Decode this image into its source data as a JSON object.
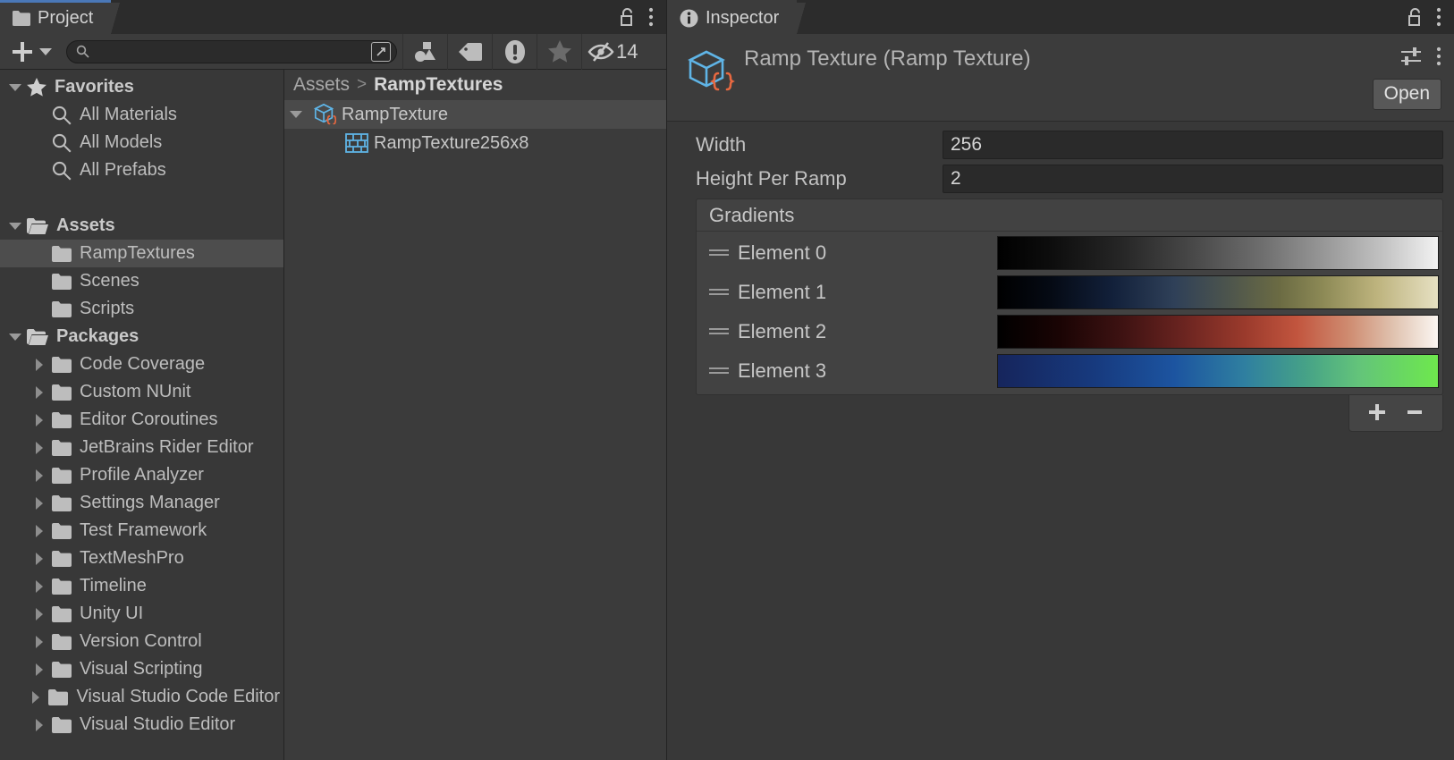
{
  "project_panel": {
    "tab_label": "Project",
    "tab_icon": "folder-icon",
    "lock_icon": "lock-open-icon",
    "menu_icon": "kebab-menu-icon",
    "toolbar": {
      "add_label": "+",
      "add_dropdown_icon": "chevron-down-icon",
      "search_placeholder": "",
      "search_value": "",
      "search_icon": "search-icon",
      "save_search_icon": "save-search-icon",
      "filter_type_icon": "filter-by-type-icon",
      "filter_label_icon": "filter-by-label-icon",
      "filter_warning_icon": "filter-by-warning-icon",
      "filter_favorite_icon": "filter-by-favorite-icon",
      "hidden_icon": "eye-crossed-icon",
      "hidden_count": "14"
    },
    "tree": [
      {
        "label": "Favorites",
        "depth": 0,
        "arrow": "down",
        "icon": "star-icon",
        "bold": true,
        "selected": false
      },
      {
        "label": "All Materials",
        "depth": 1,
        "arrow": "none",
        "icon": "search-icon",
        "bold": false,
        "selected": false
      },
      {
        "label": "All Models",
        "depth": 1,
        "arrow": "none",
        "icon": "search-icon",
        "bold": false,
        "selected": false
      },
      {
        "label": "All Prefabs",
        "depth": 1,
        "arrow": "none",
        "icon": "search-icon",
        "bold": false,
        "selected": false
      },
      {
        "label": "",
        "depth": 0,
        "arrow": "none",
        "icon": "none",
        "bold": false,
        "selected": false
      },
      {
        "label": "Assets",
        "depth": 0,
        "arrow": "down",
        "icon": "folder-open-icon",
        "bold": true,
        "selected": false
      },
      {
        "label": "RampTextures",
        "depth": 1,
        "arrow": "none",
        "icon": "folder-icon",
        "bold": false,
        "selected": true
      },
      {
        "label": "Scenes",
        "depth": 1,
        "arrow": "none",
        "icon": "folder-icon",
        "bold": false,
        "selected": false
      },
      {
        "label": "Scripts",
        "depth": 1,
        "arrow": "none",
        "icon": "folder-icon",
        "bold": false,
        "selected": false
      },
      {
        "label": "Packages",
        "depth": 0,
        "arrow": "down",
        "icon": "folder-open-icon",
        "bold": true,
        "selected": false
      },
      {
        "label": "Code Coverage",
        "depth": 1,
        "arrow": "right",
        "icon": "folder-icon",
        "bold": false,
        "selected": false
      },
      {
        "label": "Custom NUnit",
        "depth": 1,
        "arrow": "right",
        "icon": "folder-icon",
        "bold": false,
        "selected": false
      },
      {
        "label": "Editor Coroutines",
        "depth": 1,
        "arrow": "right",
        "icon": "folder-icon",
        "bold": false,
        "selected": false
      },
      {
        "label": "JetBrains Rider Editor",
        "depth": 1,
        "arrow": "right",
        "icon": "folder-icon",
        "bold": false,
        "selected": false
      },
      {
        "label": "Profile Analyzer",
        "depth": 1,
        "arrow": "right",
        "icon": "folder-icon",
        "bold": false,
        "selected": false
      },
      {
        "label": "Settings Manager",
        "depth": 1,
        "arrow": "right",
        "icon": "folder-icon",
        "bold": false,
        "selected": false
      },
      {
        "label": "Test Framework",
        "depth": 1,
        "arrow": "right",
        "icon": "folder-icon",
        "bold": false,
        "selected": false
      },
      {
        "label": "TextMeshPro",
        "depth": 1,
        "arrow": "right",
        "icon": "folder-icon",
        "bold": false,
        "selected": false
      },
      {
        "label": "Timeline",
        "depth": 1,
        "arrow": "right",
        "icon": "folder-icon",
        "bold": false,
        "selected": false
      },
      {
        "label": "Unity UI",
        "depth": 1,
        "arrow": "right",
        "icon": "folder-icon",
        "bold": false,
        "selected": false
      },
      {
        "label": "Version Control",
        "depth": 1,
        "arrow": "right",
        "icon": "folder-icon",
        "bold": false,
        "selected": false
      },
      {
        "label": "Visual Scripting",
        "depth": 1,
        "arrow": "right",
        "icon": "folder-icon",
        "bold": false,
        "selected": false
      },
      {
        "label": "Visual Studio Code Editor",
        "depth": 1,
        "arrow": "right",
        "icon": "folder-icon",
        "bold": false,
        "selected": false
      },
      {
        "label": "Visual Studio Editor",
        "depth": 1,
        "arrow": "right",
        "icon": "folder-icon",
        "bold": false,
        "selected": false
      }
    ],
    "breadcrumb": {
      "root": "Assets",
      "separator": ">",
      "current": "RampTextures"
    },
    "assets": [
      {
        "label": "RampTexture",
        "depth": 0,
        "arrow": "down",
        "icon": "scriptable-object-icon",
        "selected": true
      },
      {
        "label": "RampTexture256x8",
        "depth": 1,
        "arrow": "none",
        "icon": "texture2d-icon",
        "selected": false
      }
    ]
  },
  "inspector": {
    "tab_label": "Inspector",
    "tab_icon": "info-icon",
    "lock_icon": "lock-open-icon",
    "menu_icon": "kebab-menu-icon",
    "object_title": "Ramp Texture (Ramp Texture)",
    "object_icon": "scriptable-object-icon",
    "preset_icon": "preset-sliders-icon",
    "component_menu_icon": "kebab-menu-icon",
    "open_button": "Open",
    "fields": [
      {
        "label": "Width",
        "value": "256"
      },
      {
        "label": "Height Per Ramp",
        "value": "2"
      }
    ],
    "list": {
      "header": "Gradients",
      "add_label": "+",
      "remove_label": "−",
      "items": [
        {
          "label": "Element 0",
          "handle_icon": "drag-handle-icon",
          "gradient": "linear-gradient(to right, #000000 0%, #0d0d0d 12%, #262626 28%, #4a4a4a 45%, #6e6e6e 60%, #9a9a9a 75%, #c4c4c4 88%, #f2f2f2 100%)",
          "stops": [
            "#000000",
            "#4a4a4a",
            "#9a9a9a",
            "#f2f2f2"
          ]
        },
        {
          "label": "Element 1",
          "handle_icon": "drag-handle-icon",
          "gradient": "linear-gradient(to right, #000000 0%, #050a14 12%, #12203a 26%, #2f4058 40%, #4c544d 52%, #6b6b43 64%, #8d8a56 74%, #bdb37d 86%, #e6e0c2 100%)",
          "stops": [
            "#000000",
            "#12203a",
            "#6b6b43",
            "#e6e0c2"
          ]
        },
        {
          "label": "Element 2",
          "handle_icon": "drag-handle-icon",
          "gradient": "linear-gradient(to right, #000000 0%, #1a0404 14%, #3d1212 28%, #6a2420 42%, #9a3a2c 56%, #c2553e 68%, #cf8d72 80%, #e0c3b0 90%, #fbf6f2 100%)",
          "stops": [
            "#000000",
            "#3d1212",
            "#c2553e",
            "#fbf6f2"
          ]
        },
        {
          "label": "Element 3",
          "handle_icon": "drag-handle-icon",
          "gradient": "linear-gradient(to right, #16255c 0%, #173a7e 22%, #1c54a0 40%, #2f7fa0 56%, #46a287 70%, #63c47a 82%, #6ee84d 100%)",
          "stops": [
            "#16255c",
            "#1c54a0",
            "#46a287",
            "#6ee84d"
          ]
        }
      ]
    }
  },
  "colors": {
    "window_bg": "#383838",
    "panel_bg": "#3c3c3c",
    "tabbar_bg": "#2c2c2c",
    "selection": "#4d4d4d",
    "tab_accent": "#4a78b8",
    "text": "#c2c2c2",
    "asset_icon_blue": "#5fb4e6",
    "asset_icon_orange": "#e86840",
    "input_bg": "#2a2a2a"
  }
}
